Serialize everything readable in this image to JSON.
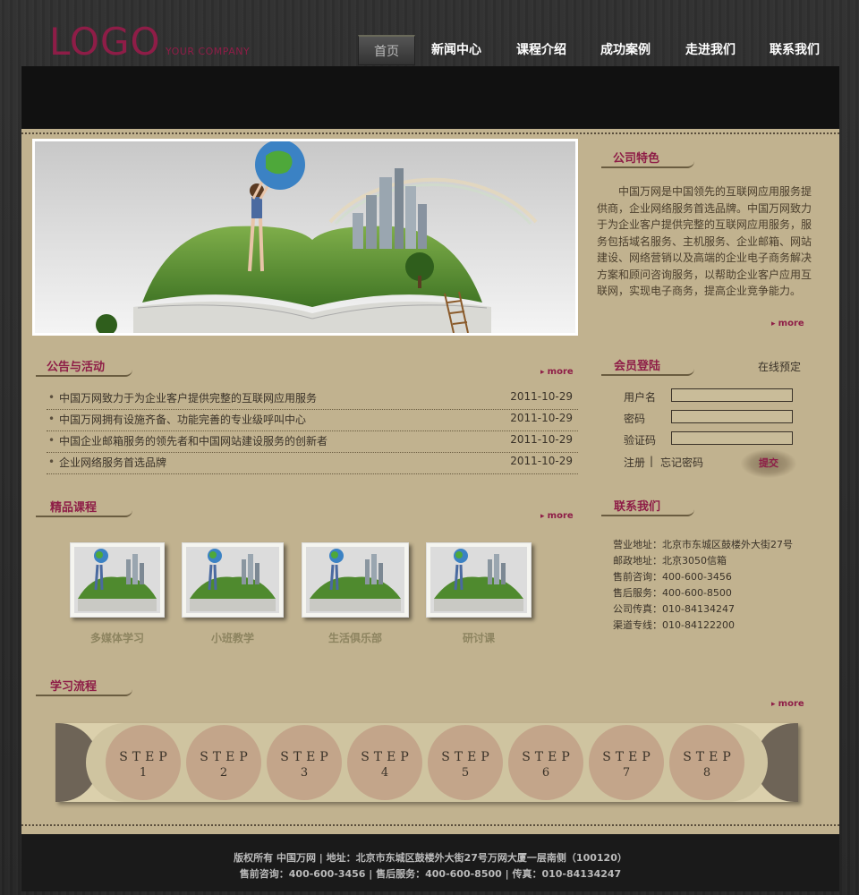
{
  "header": {
    "logo": "LOGO",
    "logo_sub": "YOUR COMPANY",
    "nav": [
      "首页",
      "新闻中心",
      "课程介绍",
      "成功案例",
      "走进我们",
      "联系我们"
    ]
  },
  "features": {
    "title": "公司特色",
    "text": "中国万网是中国领先的互联网应用服务提供商，企业网络服务首选品牌。中国万网致力于为企业客户提供完整的互联网应用服务，服务包括域名服务、主机服务、企业邮箱、网站建设、网络营销以及高端的企业电子商务解决方案和顾问咨询服务，以帮助企业客户应用互联网，实现电子商务，提高企业竞争能力。",
    "more": "more"
  },
  "news": {
    "title": "公告与活动",
    "more": "more",
    "items": [
      {
        "title": "中国万网致力于为企业客户提供完整的互联网应用服务",
        "date": "2011-10-29"
      },
      {
        "title": "中国万网拥有设施齐备、功能完善的专业级呼叫中心",
        "date": "2011-10-29"
      },
      {
        "title": "中国企业邮箱服务的领先者和中国网站建设服务的创新者",
        "date": "2011-10-29"
      },
      {
        "title": "企业网络服务首选品牌",
        "date": "2011-10-29"
      }
    ]
  },
  "login": {
    "title": "会员登陆",
    "online_booking": "在线预定",
    "username_label": "用户名",
    "password_label": "密码",
    "captcha_label": "验证码",
    "register": "注册",
    "separator": "|",
    "forgot": "忘记密码",
    "submit": "提交"
  },
  "courses": {
    "title": "精品课程",
    "more": "more",
    "items": [
      "多媒体学习",
      "小班教学",
      "生活俱乐部",
      "研讨课"
    ]
  },
  "contact": {
    "title": "联系我们",
    "lines": [
      "营业地址：北京市东城区鼓楼外大街27号",
      "邮政地址：北京3050信箱",
      "售前咨询：400-600-3456",
      "售后服务：400-600-8500",
      "公司传真：010-84134247",
      "渠道专线：010-84122200"
    ]
  },
  "process": {
    "title": "学习流程",
    "more": "more",
    "step_word": "STEP",
    "steps": [
      "1",
      "2",
      "3",
      "4",
      "5",
      "6",
      "7",
      "8"
    ]
  },
  "footer": {
    "line1": "版权所有  中国万网  |  地址：北京市东城区鼓楼外大街27号万网大厦一层南侧（100120）",
    "line2": "售前咨询：400-600-3456  |  售后服务：400-600-8500  |  传真：010-84134247"
  },
  "colors": {
    "accent": "#8e1d47",
    "panel": "#c1b28f",
    "background": "#2c2c2c"
  }
}
